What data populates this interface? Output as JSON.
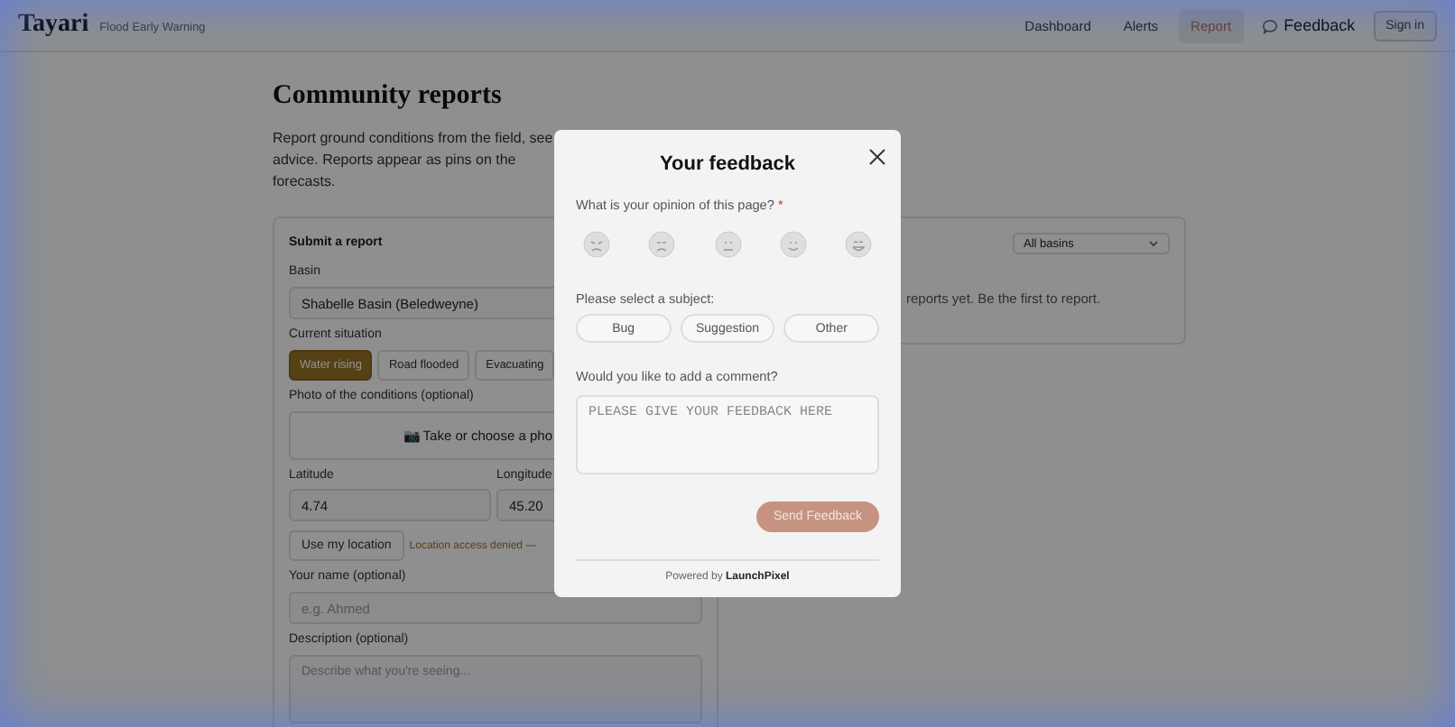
{
  "header": {
    "brand": "Tayari",
    "tagline": "Flood Early Warning",
    "nav": [
      {
        "label": "Dashboard",
        "selected": false
      },
      {
        "label": "Alerts",
        "selected": false
      },
      {
        "label": "Report",
        "selected": true
      }
    ],
    "feedback": "Feedback",
    "sign_in": "Sign in"
  },
  "page": {
    "title": "Community reports",
    "intro_lines": [
      "Report ground conditions from the field, see",
      "advice. Reports appear as pins on the",
      "forecasts."
    ]
  },
  "form": {
    "title": "Submit a report",
    "basin_label": "Basin",
    "basin_value": "Shabelle Basin (Beledweyne)",
    "situation_label": "Current situation",
    "situations": [
      {
        "label": "Water rising",
        "selected": true
      },
      {
        "label": "Road flooded",
        "selected": false
      },
      {
        "label": "Evacuating",
        "selected": false
      }
    ],
    "photo_label": "Photo of the conditions (optional)",
    "photo_button": "📷 Take or choose a pho",
    "latitude_label": "Latitude",
    "latitude_value": "4.74",
    "longitude_label": "Longitude",
    "longitude_value": "45.20",
    "location_button": "Use my location",
    "location_error": "Location access denied —",
    "name_label": "Your name (optional)",
    "name_placeholder": "e.g. Ahmed",
    "description_label": "Description (optional)",
    "description_placeholder": "Describe what you're seeing..."
  },
  "reports": {
    "filter": "All basins",
    "empty": "reports yet. Be the first to report."
  },
  "modal": {
    "title": "Your feedback",
    "question": "What is your opinion of this page?",
    "required_mark": "*",
    "ratings": [
      {
        "kind": "angry",
        "selected": false
      },
      {
        "kind": "sad",
        "selected": false
      },
      {
        "kind": "neutral",
        "selected": false
      },
      {
        "kind": "smile",
        "selected": false
      },
      {
        "kind": "happy",
        "selected": false
      }
    ],
    "subject_label": "Please select a subject:",
    "subjects": [
      {
        "label": "Bug",
        "selected": false
      },
      {
        "label": "Suggestion",
        "selected": false
      },
      {
        "label": "Other",
        "selected": false
      }
    ],
    "comment_label": "Would you like to add a comment?",
    "comment_placeholder": "PLEASE GIVE YOUR FEEDBACK HERE",
    "send": "Send Feedback",
    "powered_prefix": "Powered by",
    "powered_brand": "LaunchPixel"
  }
}
